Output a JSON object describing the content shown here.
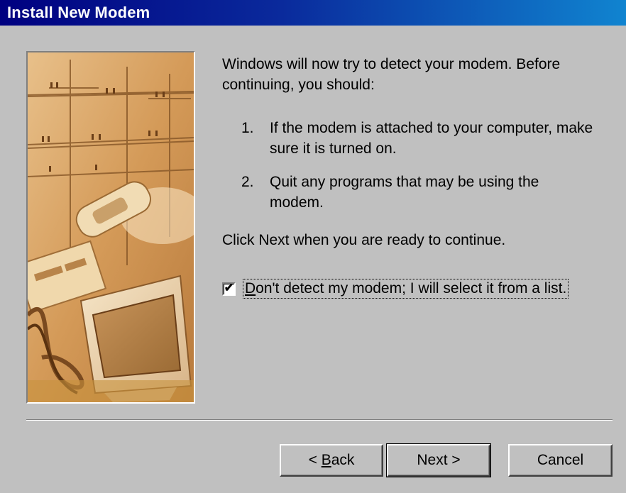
{
  "window": {
    "title": "Install New Modem"
  },
  "wizard": {
    "intro": "Windows will now try to detect your modem.  Before continuing, you should:",
    "steps": [
      {
        "num": "1.",
        "text": "If the modem is attached to your computer, make sure it is turned on."
      },
      {
        "num": "2.",
        "text": "Quit any programs that may be using the modem."
      }
    ],
    "continue_text": "Click Next when you are ready to continue.",
    "checkbox": {
      "checked": true,
      "label_mnemonic": "D",
      "label_rest": "on't detect my modem; I will select it from a list."
    }
  },
  "buttons": {
    "back_prefix": "< ",
    "back_mnemonic": "B",
    "back_rest": "ack",
    "next_label": "Next >",
    "cancel_label": "Cancel"
  },
  "colors": {
    "title_gradient_start": "#000080",
    "title_gradient_end": "#1084d0",
    "dialog_background": "#c0c0c0"
  }
}
